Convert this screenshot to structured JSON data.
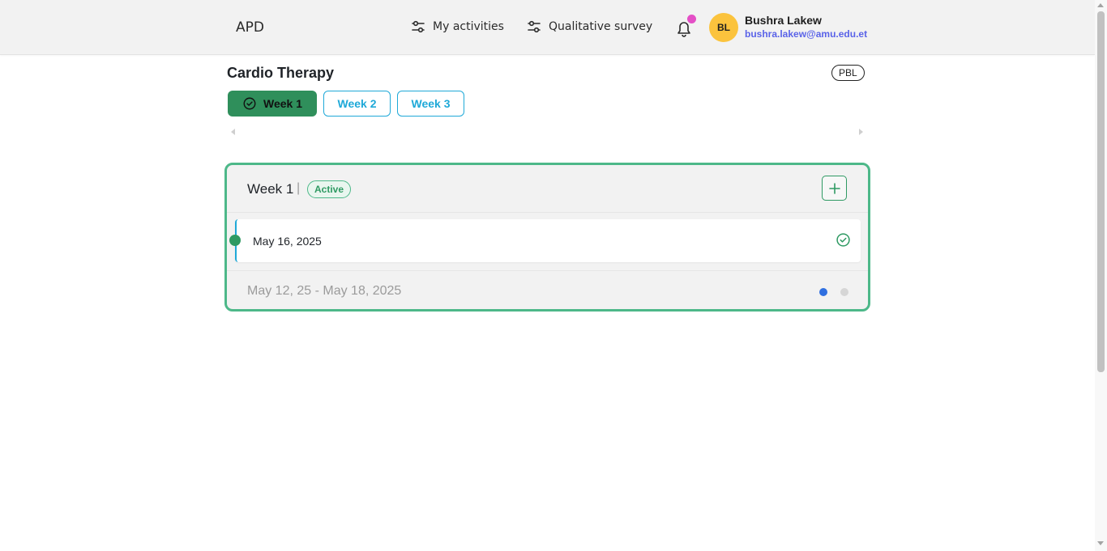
{
  "app": {
    "brand": "APD"
  },
  "nav": {
    "activities_label": "My activities",
    "activities_icon": "sliders-icon",
    "survey_label": "Qualitative survey",
    "survey_icon": "sliders-icon",
    "notifications_icon": "bell-icon",
    "notification_indicator_color": "#e44fc6"
  },
  "user": {
    "initials": "BL",
    "name": "Bushra Lakew",
    "email": "bushra.lakew@amu.edu.et",
    "avatar_color": "#fbc33d"
  },
  "course": {
    "title": "Cardio Therapy",
    "type_badge": "PBL"
  },
  "weeks": {
    "tabs": [
      {
        "label": "Week 1",
        "active": true,
        "icon": "check-circle-icon"
      },
      {
        "label": "Week 2",
        "active": false
      },
      {
        "label": "Week 3",
        "active": false
      }
    ],
    "active_color": "#2f8f5b",
    "inactive_color": "#1fa9d8"
  },
  "week_card": {
    "title": "Week 1",
    "separator": "|",
    "status": "Active",
    "add_icon": "plus-icon",
    "sessions": [
      {
        "date": "May 16, 2025",
        "status_icon": "check-circle-icon"
      }
    ],
    "date_range": "May 12, 25 - May 18, 2025",
    "pagination": {
      "current": 1,
      "total": 2
    },
    "border_color": "#4db889"
  }
}
